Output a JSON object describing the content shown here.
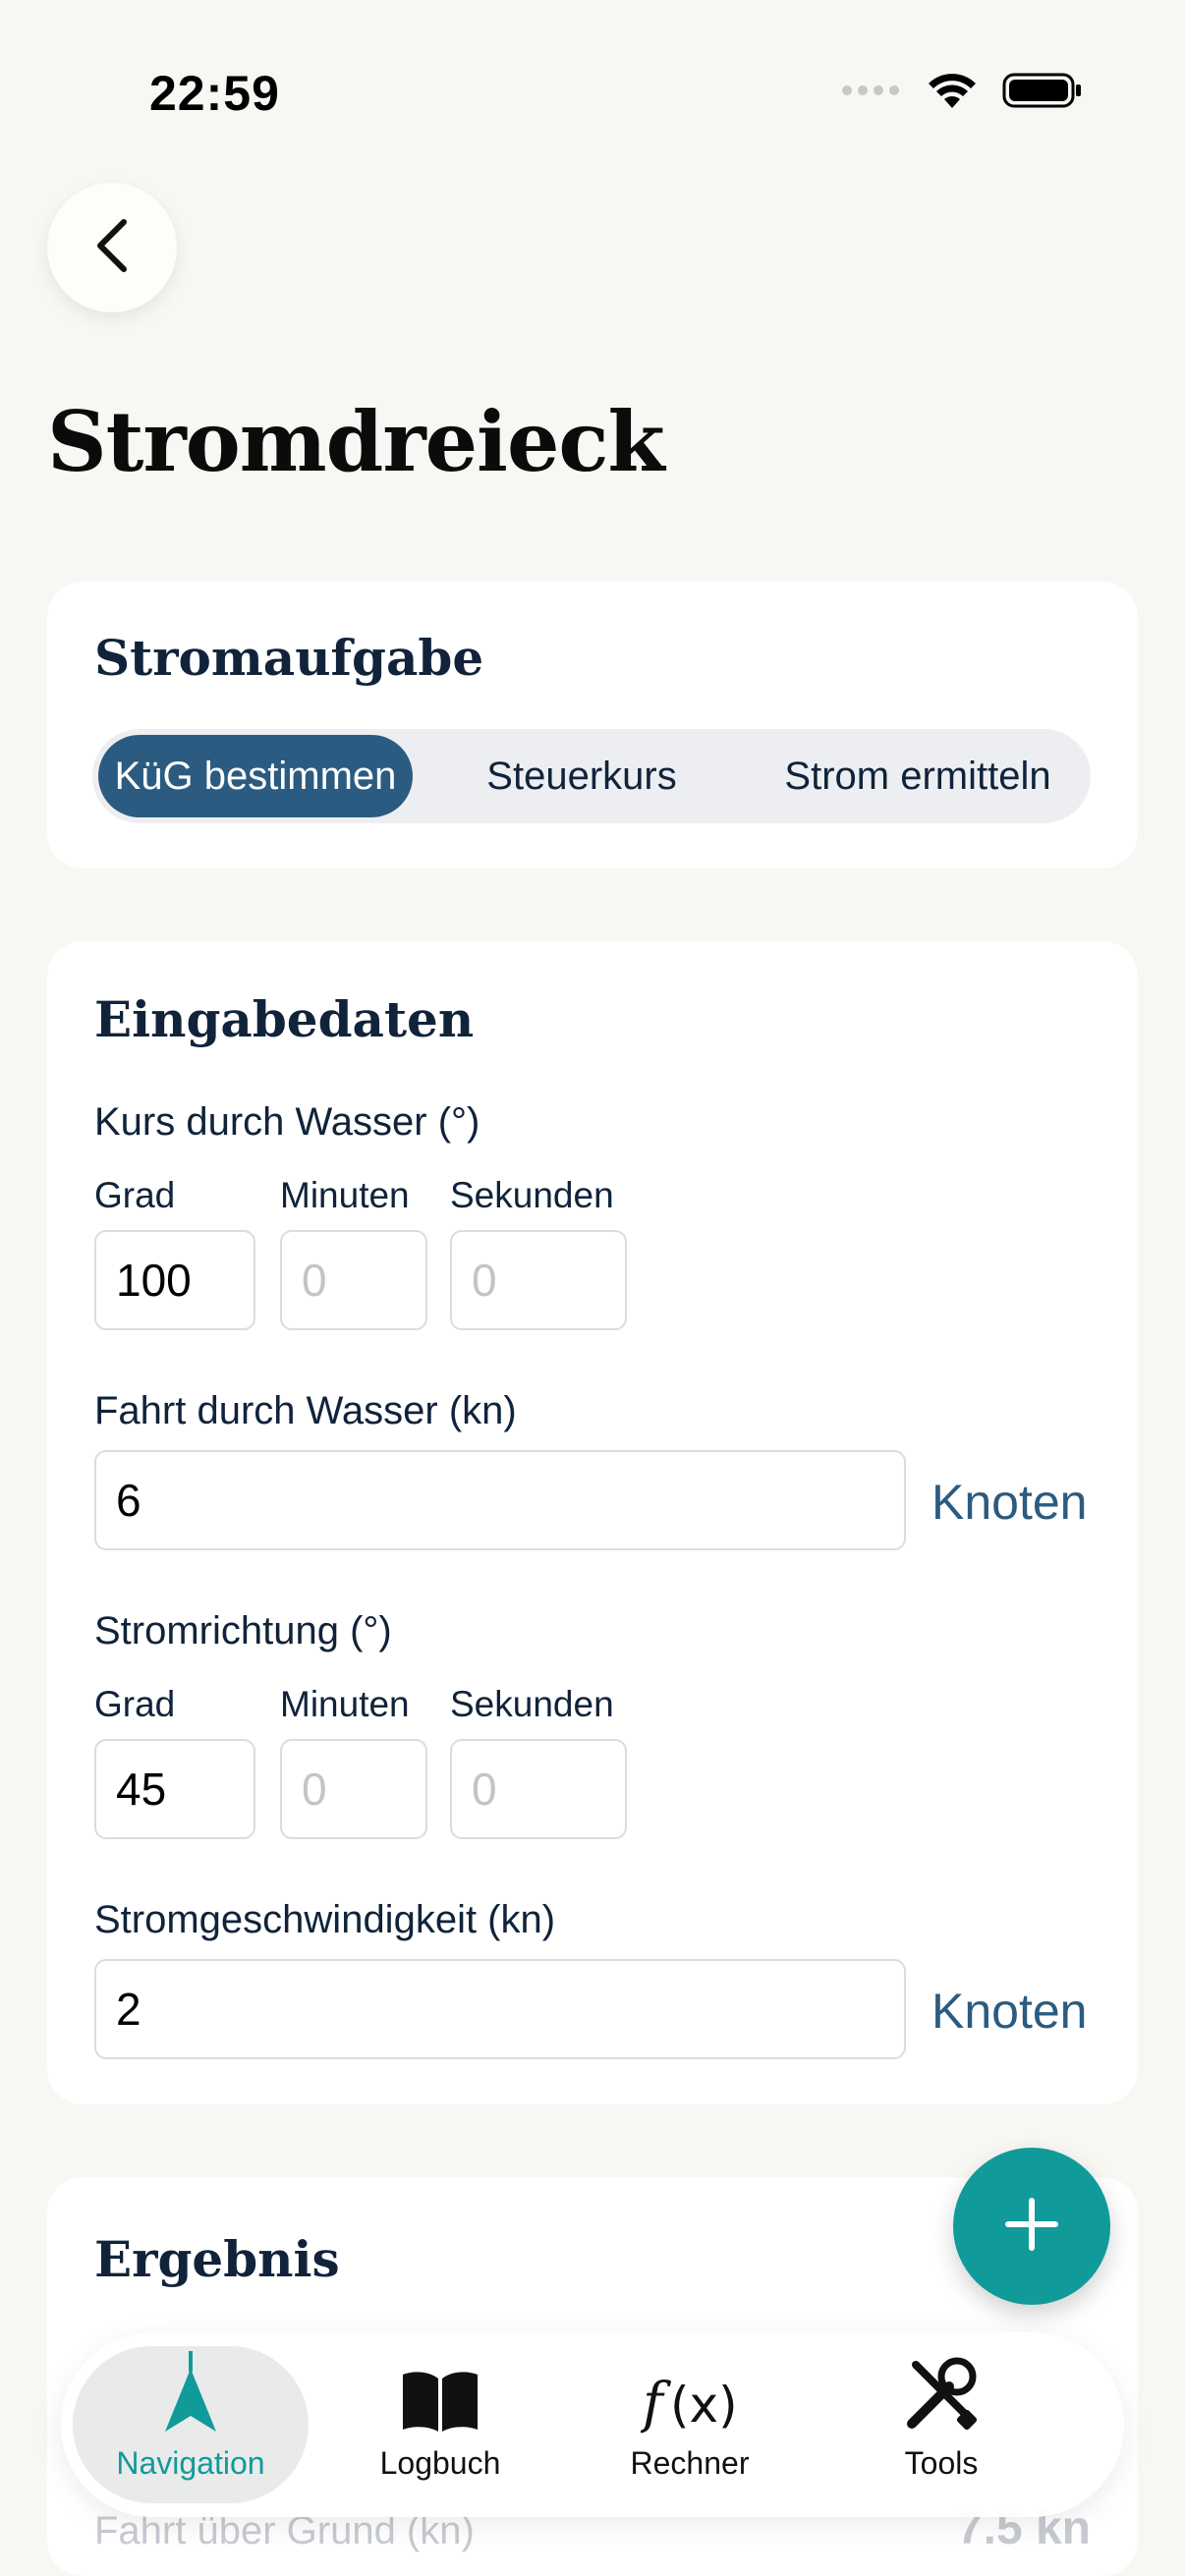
{
  "status": {
    "time": "22:59"
  },
  "page": {
    "title": "Stromdreieck"
  },
  "task_card": {
    "title": "Stromaufgabe",
    "segments": [
      "KüG bestimmen",
      "Steuerkurs",
      "Strom ermitteln"
    ]
  },
  "input_card": {
    "title": "Eingabedaten",
    "kdw": {
      "label": "Kurs durch Wasser (°)",
      "grad_label": "Grad",
      "min_label": "Minuten",
      "sek_label": "Sekunden",
      "grad_value": "100",
      "min_placeholder": "0",
      "sek_placeholder": "0"
    },
    "fdw": {
      "label": "Fahrt durch Wasser (kn)",
      "value": "6",
      "unit": "Knoten"
    },
    "stromrichtung": {
      "label": "Stromrichtung (°)",
      "grad_label": "Grad",
      "min_label": "Minuten",
      "sek_label": "Sekunden",
      "grad_value": "45",
      "min_placeholder": "0",
      "sek_placeholder": "0"
    },
    "stromgeschwindigkeit": {
      "label": "Stromgeschwindigkeit (kn)",
      "value": "2",
      "unit": "Knoten"
    }
  },
  "result_card": {
    "title": "Ergebnis",
    "row_label": "Fahrt über Grund (kn)",
    "row_value": "7.5 kn"
  },
  "tabbar": {
    "tabs": [
      {
        "label": "Navigation",
        "icon": "navigation-arrow-icon"
      },
      {
        "label": "Logbuch",
        "icon": "book-icon"
      },
      {
        "label": "Rechner",
        "icon": "function-icon"
      },
      {
        "label": "Tools",
        "icon": "tools-icon"
      }
    ]
  },
  "colors": {
    "accent": "#119a9a",
    "primary": "#2b5b80",
    "background": "#f8f7f4"
  }
}
